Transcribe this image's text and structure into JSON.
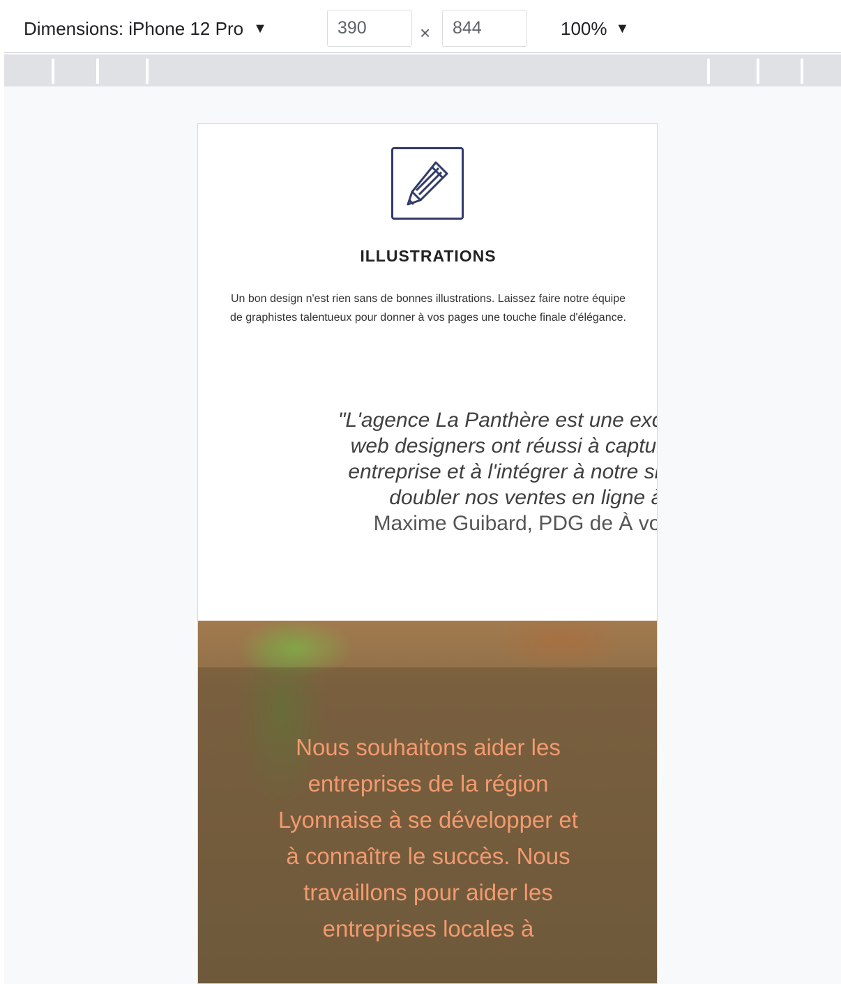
{
  "toolbar": {
    "dimensions_label": "Dimensions: iPhone 12 Pro",
    "width_value": "390",
    "times_symbol": "×",
    "height_value": "844",
    "zoom_label": "100%",
    "caret": "▼"
  },
  "page": {
    "icon": "pencil-icon",
    "section_title": "ILLUSTRATIONS",
    "section_text": "Un bon design n'est rien sans de bonnes illustrations. Laissez faire notre équipe de graphistes talentueux pour donner à vos pages une touche finale d'élégance.",
    "quote_lines": [
      "\"L'agence La Panthère est une excellente a",
      "web designers ont réussi à capturer l'ess",
      "entreprise et à l'intégrer à notre site. Cela",
      "doubler nos ventes en ligne à Ly"
    ],
    "quote_author": "Maxime Guibard, PDG de À vos fou",
    "hero_text": "Nous souhaitons aider les entreprises de la région Lyonnaise à se développer et à connaître le succès. Nous travaillons pour aider les entreprises locales à"
  },
  "colors": {
    "icon_stroke": "#323b6a",
    "hero_text": "#f39a6f",
    "hero_bg": "#8b6d48"
  }
}
